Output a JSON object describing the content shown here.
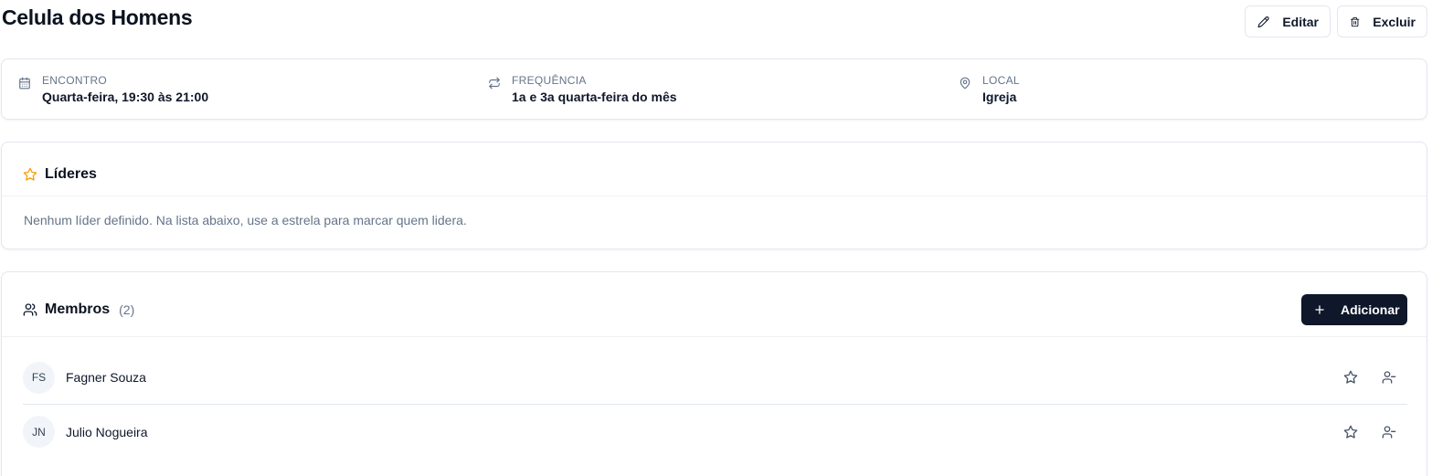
{
  "header": {
    "title": "Celula dos Homens",
    "edit_label": "Editar",
    "delete_label": "Excluir"
  },
  "info": {
    "meeting": {
      "label": "ENCONTRO",
      "value": "Quarta-feira, 19:30 às 21:00",
      "icon": "calendar-icon"
    },
    "frequency": {
      "label": "FREQUÊNCIA",
      "value": "1a e 3a quarta-feira do mês",
      "icon": "repeat-icon"
    },
    "location": {
      "label": "LOCAL",
      "value": "Igreja",
      "icon": "map-pin-icon"
    }
  },
  "leaders": {
    "title": "Líderes",
    "empty_text": "Nenhum líder definido. Na lista abaixo, use a estrela para marcar quem lidera.",
    "accent": "#f59e0b"
  },
  "members": {
    "title": "Membros",
    "count": "(2)",
    "add_label": "Adicionar",
    "items": [
      {
        "initials": "FS",
        "name": "Fagner Souza"
      },
      {
        "initials": "JN",
        "name": "Julio Nogueira"
      }
    ]
  }
}
